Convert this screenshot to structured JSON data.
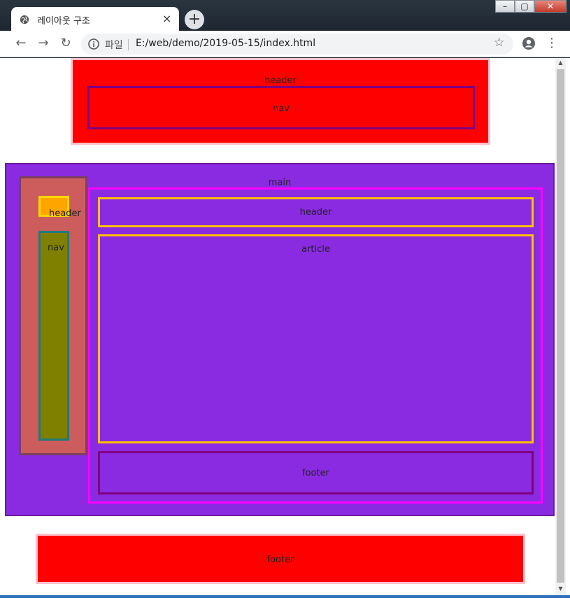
{
  "browser": {
    "tab_title": "레이아웃 구조",
    "tab_close": "×",
    "new_tab": "+",
    "url_scheme": "파일",
    "url": "E:/web/demo/2019-05-15/index.html",
    "window_buttons": {
      "minimize": "–",
      "maximize": "▢",
      "close": "✕"
    }
  },
  "page": {
    "header": {
      "label": "header",
      "nav_label": "nav"
    },
    "main": {
      "label": "main",
      "aside": {
        "header_label": "header",
        "nav_label": "nav"
      },
      "section": {
        "header_label": "header",
        "article_label": "article",
        "footer_label": "footer"
      }
    },
    "footer": {
      "label": "footer"
    }
  },
  "colors": {
    "red": "#ff0000",
    "purple": "#8a2be2",
    "indianred": "#cd5c5c",
    "olive": "#808000",
    "orange": "#ffa500",
    "magenta": "#ff00ff",
    "gold": "#ffc000"
  }
}
